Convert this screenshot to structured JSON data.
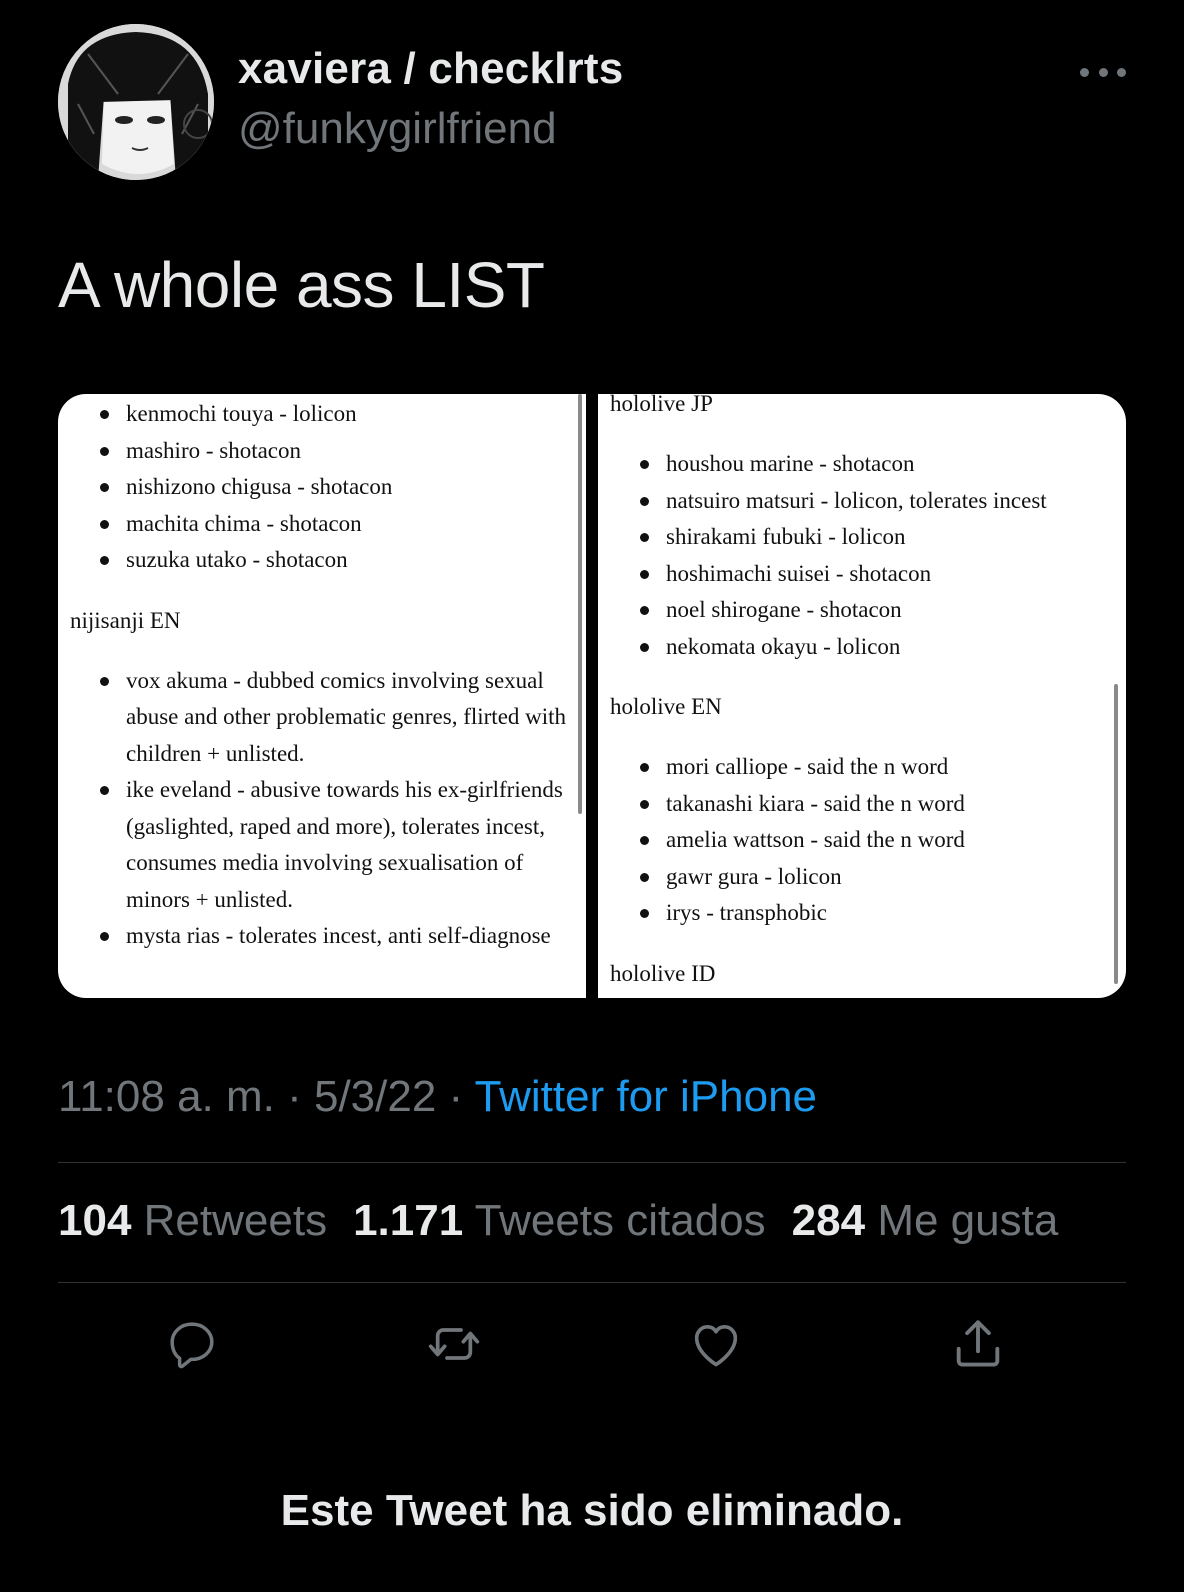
{
  "author": {
    "name": "xaviera / checklrts",
    "handle": "@funkygirlfriend"
  },
  "tweet": {
    "text": "A whole ass LIST"
  },
  "media": {
    "left_panel": {
      "items_top": [
        "kenmochi touya - lolicon",
        "mashiro - shotacon",
        "nishizono chigusa - shotacon",
        "machita chima - shotacon",
        "suzuka utako - shotacon"
      ],
      "section": "nijisanji EN",
      "items_bottom": [
        "vox akuma - dubbed comics involving sexual abuse and other problematic genres, flirted with children + unlisted.",
        "ike eveland - abusive towards his ex-girlfriends (gaslighted, raped and more), tolerates incest, consumes media involving sexualisation of minors + unlisted.",
        "mysta rias - tolerates incest, anti self-diagnose"
      ]
    },
    "right_panel": {
      "section1": "hololive JP",
      "items1": [
        "houshou marine - shotacon",
        "natsuiro matsuri - lolicon, tolerates incest",
        "shirakami fubuki - lolicon",
        "hoshimachi suisei - shotacon",
        "noel shirogane - shotacon",
        "nekomata okayu - lolicon"
      ],
      "section2": "hololive EN",
      "items2": [
        "mori calliope - said the n word",
        "takanashi kiara - said the n word",
        "amelia wattson - said the n word",
        "gawr gura - lolicon",
        "irys - transphobic"
      ],
      "section3": "hololive ID"
    }
  },
  "meta": {
    "time": "11:08 a. m.",
    "sep1": " · ",
    "date": "5/3/22",
    "sep2": " · ",
    "source": "Twitter for iPhone"
  },
  "stats": {
    "retweets_count": "104",
    "retweets_label": "Retweets",
    "quotes_count": "1.171",
    "quotes_label": "Tweets citados",
    "likes_count": "284",
    "likes_label": "Me gusta"
  },
  "actions": {
    "reply_icon": "reply-icon",
    "retweet_icon": "retweet-icon",
    "like_icon": "heart-icon",
    "share_icon": "share-icon"
  },
  "status": {
    "deleted_notice": "Este Tweet ha sido eliminado."
  },
  "colors": {
    "background": "#000000",
    "text_primary": "#e7e9ea",
    "text_secondary": "#71767b",
    "link": "#1d9bf0",
    "divider": "#2f3336"
  }
}
